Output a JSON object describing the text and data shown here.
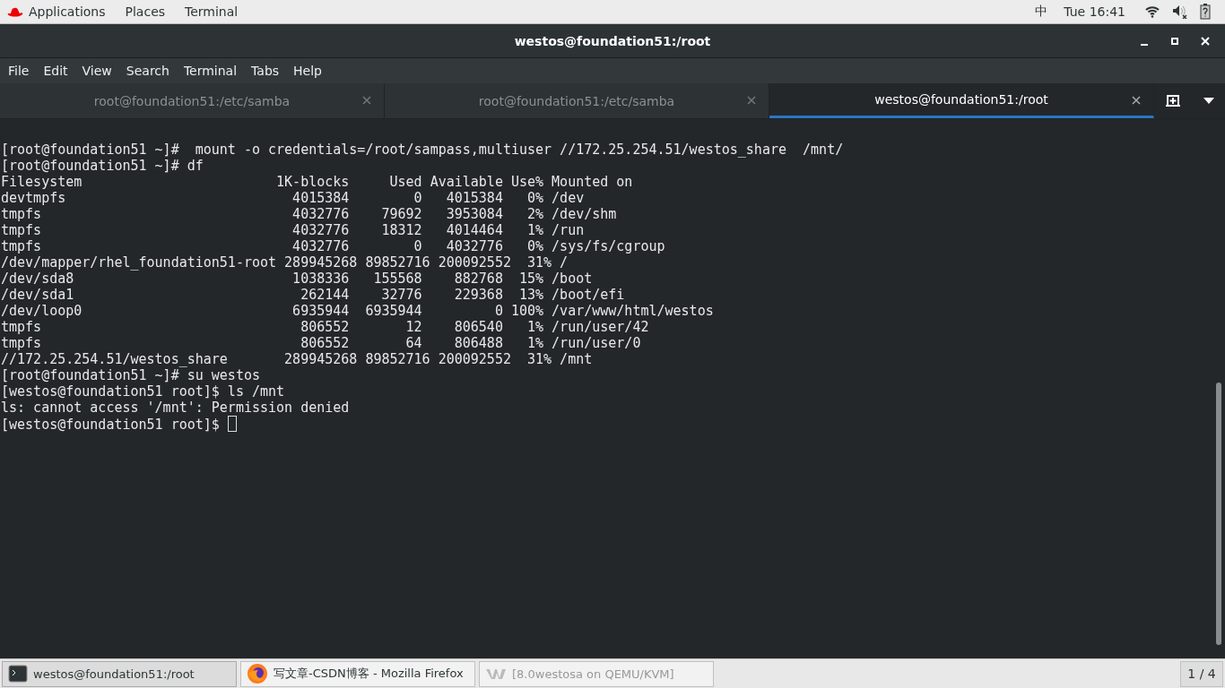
{
  "top_bar": {
    "menus": [
      "Applications",
      "Places",
      "Terminal"
    ],
    "input_method": "中",
    "clock": "Tue 16:41"
  },
  "window": {
    "title": "westos@foundation51:/root"
  },
  "menu_bar": [
    "File",
    "Edit",
    "View",
    "Search",
    "Terminal",
    "Tabs",
    "Help"
  ],
  "tabs": [
    {
      "label": "root@foundation51:/etc/samba",
      "selected": false
    },
    {
      "label": "root@foundation51:/etc/samba",
      "selected": false
    },
    {
      "label": "westos@foundation51:/root",
      "selected": true
    }
  ],
  "terminal": {
    "lines": [
      "[root@foundation51 ~]#  mount -o credentials=/root/sampass,multiuser //172.25.254.51/westos_share  /mnt/",
      "[root@foundation51 ~]# df",
      "Filesystem                        1K-blocks     Used Available Use% Mounted on",
      "devtmpfs                            4015384        0   4015384   0% /dev",
      "tmpfs                               4032776    79692   3953084   2% /dev/shm",
      "tmpfs                               4032776    18312   4014464   1% /run",
      "tmpfs                               4032776        0   4032776   0% /sys/fs/cgroup",
      "/dev/mapper/rhel_foundation51-root 289945268 89852716 200092552  31% /",
      "/dev/sda8                           1038336   155568    882768  15% /boot",
      "/dev/sda1                            262144    32776    229368  13% /boot/efi",
      "/dev/loop0                          6935944  6935944         0 100% /var/www/html/westos",
      "tmpfs                                806552       12    806540   1% /run/user/42",
      "tmpfs                                806552       64    806488   1% /run/user/0",
      "//172.25.254.51/westos_share       289945268 89852716 200092552  31% /mnt",
      "[root@foundation51 ~]# su westos",
      "[westos@foundation51 root]$ ls /mnt",
      "ls: cannot access '/mnt': Permission denied",
      "[westos@foundation51 root]$ "
    ]
  },
  "taskbar": {
    "items": [
      {
        "kind": "terminal",
        "label": "westos@foundation51:/root",
        "selected": true,
        "minimized": false
      },
      {
        "kind": "firefox",
        "label": "写文章-CSDN博客 - Mozilla Firefox",
        "selected": false,
        "minimized": false
      },
      {
        "kind": "vm",
        "label": "[8.0westosa on QEMU/KVM]",
        "selected": false,
        "minimized": true
      }
    ],
    "workspace": "1 / 4"
  }
}
